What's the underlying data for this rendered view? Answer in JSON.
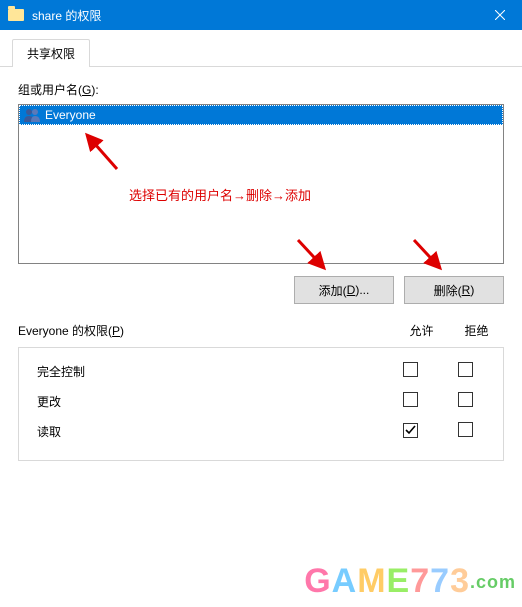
{
  "title": "share 的权限",
  "tab": "共享权限",
  "groupLabelPrefix": "组或用户名(",
  "groupLabelKey": "G",
  "groupLabelSuffix": "):",
  "list": {
    "item0": "Everyone"
  },
  "annotation": "选择已有的用户名→删除→添加",
  "buttons": {
    "addPrefix": "添加(",
    "addKey": "D",
    "addSuffix": ")...",
    "removePrefix": "删除(",
    "removeKey": "R",
    "removeSuffix": ")"
  },
  "permHeader": {
    "prefix": "Everyone 的权限(",
    "key": "P",
    "suffix": ")",
    "allow": "允许",
    "deny": "拒绝"
  },
  "perms": {
    "full": "完全控制",
    "change": "更改",
    "read": "读取"
  },
  "watermark": {
    "text": "GAME773",
    "suffix": ".com"
  }
}
